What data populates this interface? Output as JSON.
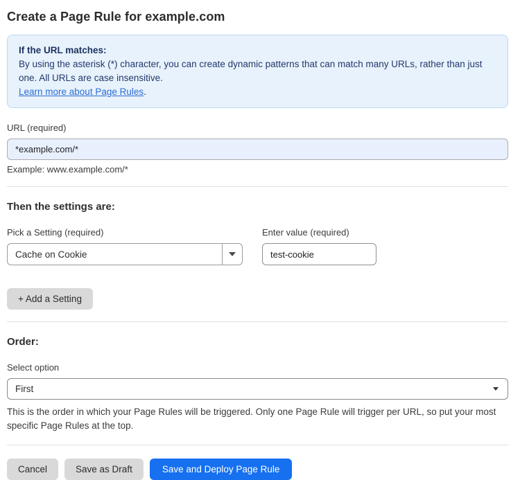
{
  "page": {
    "title": "Create a Page Rule for example.com"
  },
  "info_box": {
    "heading": "If the URL matches:",
    "body": "By using the asterisk (*) character, you can create dynamic patterns that can match many URLs, rather than just one. All URLs are case insensitive.",
    "link_label": "Learn more about Page Rules",
    "link_suffix": "."
  },
  "url_field": {
    "label": "URL (required)",
    "value": "*example.com/*",
    "helper": "Example: www.example.com/*"
  },
  "settings": {
    "heading": "Then the settings are:",
    "setting_label": "Pick a Setting (required)",
    "setting_selected": "Cache on Cookie",
    "value_label": "Enter value (required)",
    "value": "test-cookie",
    "add_button_label": "+ Add a Setting"
  },
  "order": {
    "heading": "Order:",
    "label": "Select option",
    "selected": "First",
    "help": "This is the order in which your Page Rules will be triggered. Only one Page Rule will trigger per URL, so put your most specific Page Rules at the top."
  },
  "actions": {
    "cancel_label": "Cancel",
    "save_draft_label": "Save as Draft",
    "save_deploy_label": "Save and Deploy Page Rule"
  },
  "icons": {
    "dropdown_arrow": "caret-down-icon"
  },
  "colors": {
    "accent_blue": "#1670f0",
    "info_bg": "#e8f2fc",
    "info_border": "#b9d7f1",
    "info_text": "#21386b",
    "link_blue": "#2b6cd4",
    "autofill_bg": "#e8f0fe",
    "button_gray": "#d9d9d9",
    "divider_gray": "#e0e0e0"
  }
}
